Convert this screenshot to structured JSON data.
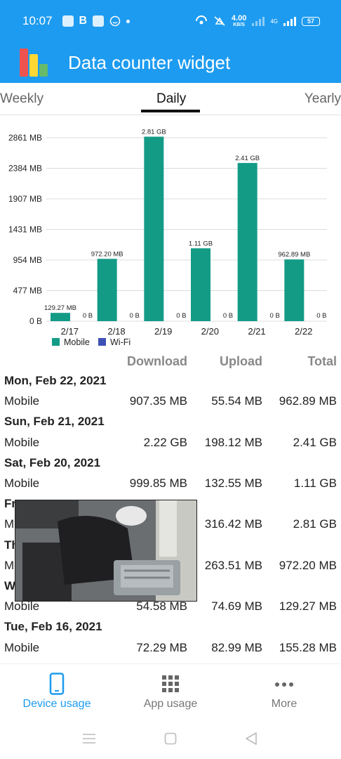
{
  "status_bar": {
    "time": "10:07",
    "letter_b": "B",
    "net_speed": "4.00",
    "net_speed_unit": "KB/S",
    "network_type": "4G",
    "battery": "57"
  },
  "app": {
    "title": "Data counter widget",
    "accent": "#1d9bf0",
    "logo_colors": [
      "#ef5350",
      "#fdd835",
      "#66bb6a"
    ]
  },
  "tabs": {
    "weekly": "Weekly",
    "daily": "Daily",
    "yearly": "Yearly",
    "selected": "Daily"
  },
  "chart_data": {
    "type": "bar",
    "categories": [
      "2/17",
      "2/18",
      "2/19",
      "2/20",
      "2/21",
      "2/22"
    ],
    "y_ticks": [
      "0 B",
      "477 MB",
      "954 MB",
      "1431 MB",
      "1907 MB",
      "2384 MB",
      "2861 MB"
    ],
    "ylim": [
      0,
      2861
    ],
    "series": [
      {
        "name": "Mobile",
        "color": "#139b86",
        "values": [
          129.27,
          972.2,
          2877.44,
          1136.64,
          2467.84,
          962.89
        ],
        "labels": [
          "129.27 MB",
          "972.20 MB",
          "2.81 GB",
          "1.11 GB",
          "2.41 GB",
          "962.89 MB"
        ]
      },
      {
        "name": "Wi-Fi",
        "color": "#3f51b5",
        "values": [
          0,
          0,
          0,
          0,
          0,
          0
        ],
        "labels": [
          "0 B",
          "0 B",
          "0 B",
          "0 B",
          "0 B",
          "0 B"
        ]
      }
    ],
    "grid": true,
    "legend": "bottom-left"
  },
  "table": {
    "headers": {
      "download": "Download",
      "upload": "Upload",
      "total": "Total"
    },
    "days": [
      {
        "date": "Mon, Feb 22, 2021",
        "type": "Mobile",
        "download": "907.35 MB",
        "upload": "55.54 MB",
        "total": "962.89 MB"
      },
      {
        "date": "Sun, Feb 21, 2021",
        "type": "Mobile",
        "download": "2.22 GB",
        "upload": "198.12 MB",
        "total": "2.41 GB"
      },
      {
        "date": "Sat, Feb 20, 2021",
        "type": "Mobile",
        "download": "999.85 MB",
        "upload": "132.55 MB",
        "total": "1.11 GB"
      },
      {
        "date": "Fr",
        "type": "M",
        "download": "",
        "upload": "316.42 MB",
        "total": "2.81 GB"
      },
      {
        "date": "Th",
        "type": "M",
        "download": "",
        "upload": "263.51 MB",
        "total": "972.20 MB"
      },
      {
        "date": "W",
        "type": "Mobile",
        "download": "54.58 MB",
        "upload": "74.69 MB",
        "total": "129.27 MB"
      },
      {
        "date": "Tue, Feb 16, 2021",
        "type": "Mobile",
        "download": "72.29 MB",
        "upload": "82.99 MB",
        "total": "155.28 MB"
      }
    ]
  },
  "bottom_nav": {
    "device_usage": "Device usage",
    "app_usage": "App usage",
    "more": "More",
    "selected": "Device usage"
  },
  "icons": {
    "device": "phone-icon",
    "apps": "grid-icon",
    "more": "more-dots-icon"
  }
}
